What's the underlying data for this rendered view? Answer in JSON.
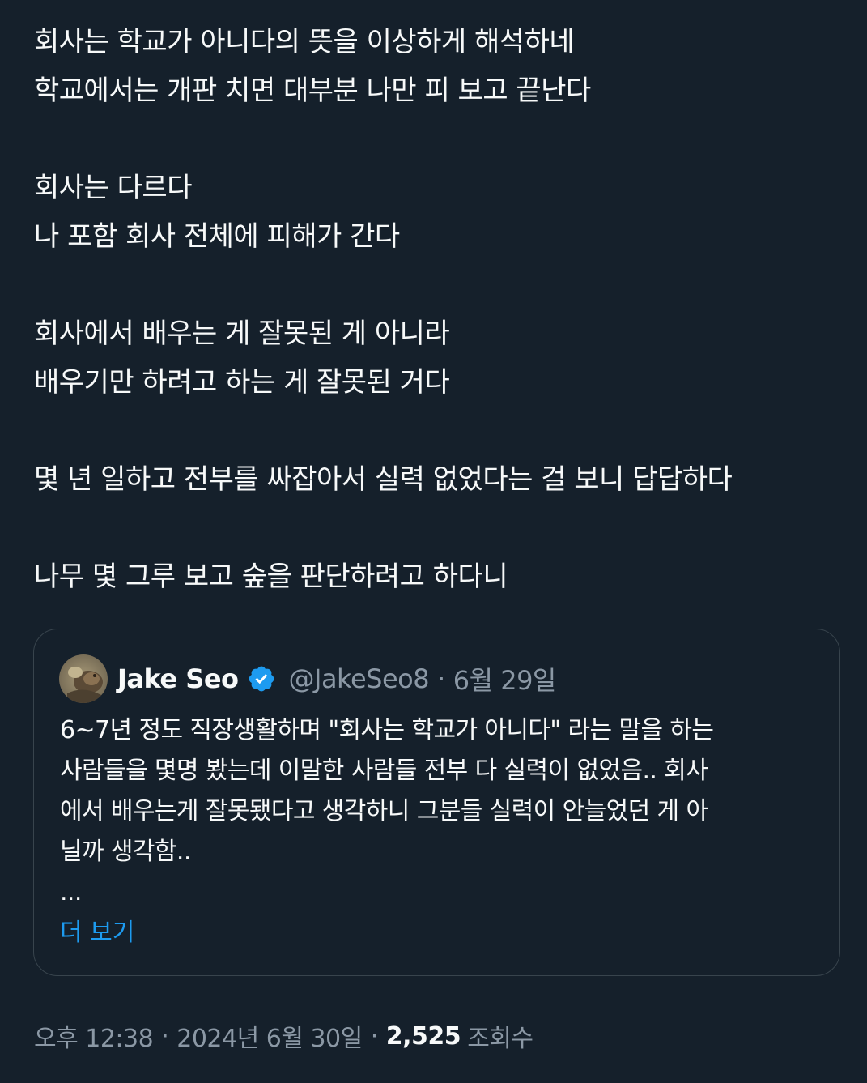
{
  "tweet": {
    "paragraphs": [
      [
        "회사는 학교가 아니다의 뜻을 이상하게 해석하네",
        "학교에서는 개판 치면 대부분 나만 피 보고 끝난다"
      ],
      [
        "회사는 다르다",
        "나 포함 회사 전체에 피해가 간다"
      ],
      [
        "회사에서 배우는 게 잘못된 게 아니라",
        "배우기만 하려고 하는 게 잘못된 거다"
      ],
      [
        "몇 년 일하고 전부를 싸잡아서 실력 없었다는 걸 보니 답답하다"
      ],
      [
        "나무 몇 그루 보고 숲을 판단하려고 하다니"
      ]
    ]
  },
  "quote": {
    "author_name": "Jake Seo",
    "verified_icon": "verified-badge-icon",
    "handle": "@JakeSeo8",
    "separator": "·",
    "date": "6월 29일",
    "lines": [
      "6~7년 정도 직장생활하며 \"회사는 학교가 아니다\" 라는 말을 하는",
      "사람들을 몇명 봤는데 이말한 사람들 전부 다 실력이 없었음.. 회사",
      "에서 배우는게 잘못됐다고 생각하니 그분들 실력이 안늘었던 게 아",
      "닐까 생각함..",
      "..."
    ],
    "more_label": "더 보기"
  },
  "meta": {
    "time": "오후 12:38",
    "separator": "·",
    "date": "2024년 6월 30일",
    "views_count": "2,525",
    "views_label": "조회수"
  },
  "colors": {
    "background": "#15202b",
    "text_primary": "#f7f9f9",
    "text_secondary": "#8b98a5",
    "link": "#1d9bf0",
    "border": "#38444d",
    "verified": "#1d9bf0"
  }
}
